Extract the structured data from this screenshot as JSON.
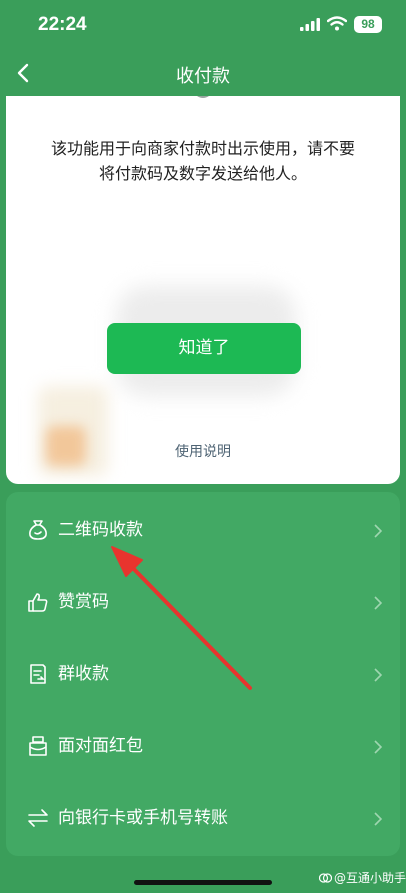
{
  "status": {
    "time": "22:24",
    "battery": "98"
  },
  "nav": {
    "title": "收付款"
  },
  "card": {
    "notice_line1": "该功能用于向商家付款时出示使用，请不要",
    "notice_line2": "将付款码及数字发送给他人。",
    "ok_label": "知道了",
    "usage_label": "使用说明"
  },
  "menu": {
    "items": [
      {
        "label": "二维码收款",
        "icon": "money-bag-icon"
      },
      {
        "label": "赞赏码",
        "icon": "thumbs-up-icon"
      },
      {
        "label": "群收款",
        "icon": "group-bill-icon"
      },
      {
        "label": "面对面红包",
        "icon": "red-packet-icon"
      },
      {
        "label": "向银行卡或手机号转账",
        "icon": "transfer-icon"
      }
    ]
  },
  "watermark": "@互通小助手",
  "colors": {
    "background": "#3a9e5a",
    "menu": "#42a964",
    "button": "#1db954",
    "arrow": "#e8342e"
  }
}
